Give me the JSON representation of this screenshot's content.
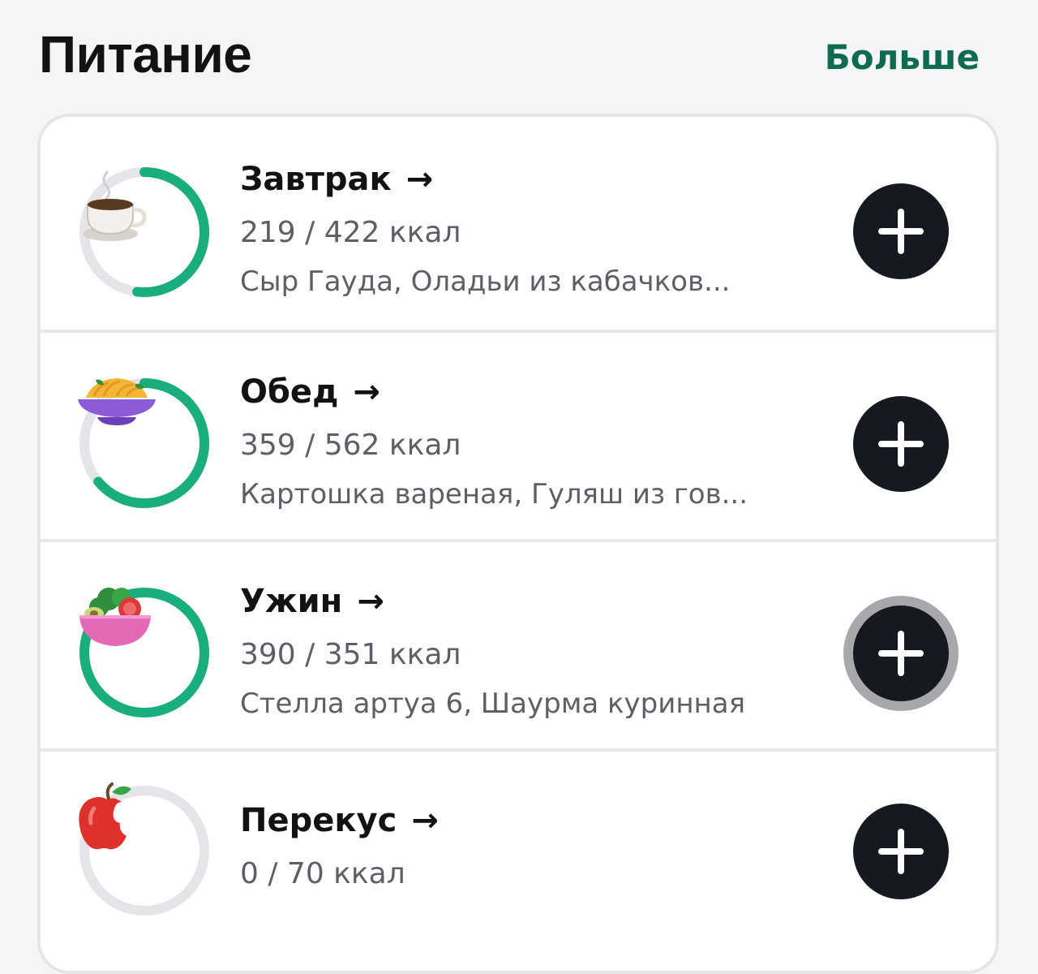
{
  "header": {
    "title": "Питание",
    "more_label": "Больше"
  },
  "colors": {
    "accent": "#1aae7e",
    "ring_track": "#e3e5e8",
    "add_button": "#161a20",
    "link": "#0f6b4f"
  },
  "meals": [
    {
      "title": "Завтрак",
      "arrow": "→",
      "kcal": "219 / 422 ккал",
      "foods": "Сыр Гауда, Оладьи из кабачков...",
      "icon": "coffee-cup-icon",
      "progress": 0.519
    },
    {
      "title": "Обед",
      "arrow": "→",
      "kcal": "359 / 562 ккал",
      "foods": "Картошка вареная, Гуляш из гов...",
      "icon": "pasta-plate-icon",
      "progress": 0.639
    },
    {
      "title": "Ужин",
      "arrow": "→",
      "kcal": "390 / 351 ккал",
      "foods": "Стелла артуа 6, Шаурма куринная",
      "icon": "salad-bowl-icon",
      "progress": 1.0
    },
    {
      "title": "Перекус",
      "arrow": "→",
      "kcal": "0 / 70 ккал",
      "foods": "",
      "icon": "apple-icon",
      "progress": 0
    }
  ]
}
